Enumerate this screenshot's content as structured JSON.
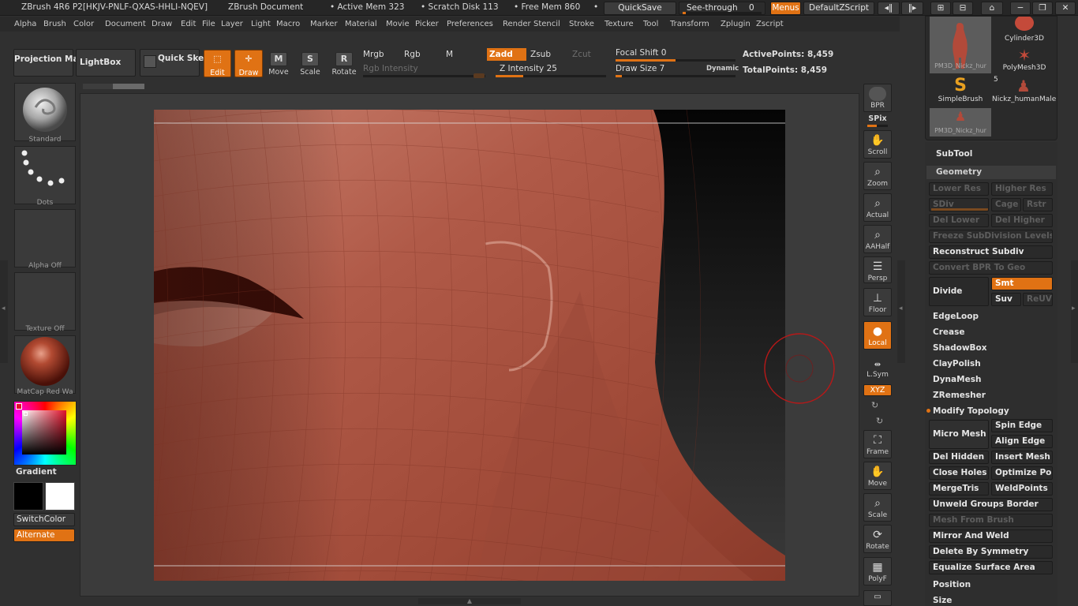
{
  "titlebar": {
    "app_title": "ZBrush 4R6 P2[HKJV-PNLF-QXAS-HHLI-NQEV]",
    "document": "ZBrush Document",
    "active_mem": "• Active Mem 323",
    "scratch_disk": "• Scratch Disk 113",
    "free_mem": "• Free Mem 860",
    "dot": "•",
    "quicksave": "QuickSave",
    "see_through_label": "See-through",
    "see_through_value": "0",
    "see_through_level": 0,
    "menus": "Menus",
    "default_zscript": "DefaultZScript"
  },
  "menubar": {
    "items": [
      "Alpha",
      "Brush",
      "Color",
      "Document",
      "Draw",
      "Edit",
      "File",
      "Layer",
      "Light",
      "Macro",
      "Marker",
      "Material",
      "Movie",
      "Picker",
      "Preferences",
      "Render",
      "Stencil",
      "Stroke",
      "Texture",
      "Tool",
      "Transform",
      "Zplugin",
      "Zscript"
    ]
  },
  "shelf": {
    "projection_master": "Projection Master",
    "lightbox": "LightBox",
    "quick_sketch": "Quick Sketch",
    "edit": "Edit",
    "draw": "Draw",
    "move": "Move",
    "scale": "Scale",
    "rotate": "Rotate",
    "mrgb": "Mrgb",
    "rgb": "Rgb",
    "m": "M",
    "zadd": "Zadd",
    "zsub": "Zsub",
    "zcut": "Zcut",
    "rgb_intensity": "Rgb Intensity",
    "z_intensity_label": "Z Intensity",
    "z_intensity_value": "25",
    "focal_shift_label": "Focal Shift",
    "focal_shift_value": "0",
    "draw_size_label": "Draw Size",
    "draw_size_value": "7",
    "dynamic": "Dynamic",
    "active_points": "ActivePoints: 8,459",
    "total_points": "TotalPoints: 8,459",
    "z_intensity_level": 25,
    "focal_shift_level": 50,
    "draw_size_level": 5
  },
  "lefttray": {
    "standard": "Standard",
    "dots": "Dots",
    "alpha_off": "Alpha Off",
    "texture_off": "Texture Off",
    "matcap": "MatCap Red Wa",
    "gradient": "Gradient",
    "switchcolor": "SwitchColor",
    "alternate": "Alternate"
  },
  "righttools": {
    "bpr": "BPR",
    "spix": "SPix",
    "scroll": "Scroll",
    "zoom": "Zoom",
    "actual": "Actual",
    "aahalf": "AAHalf",
    "persp": "Persp",
    "floor": "Floor",
    "local": "Local",
    "lsym": "L.Sym",
    "xyz": "XYZ",
    "frame": "Frame",
    "move": "Move",
    "scale": "Scale",
    "rotate": "Rotate",
    "polyf": "PolyF"
  },
  "toolpalette": {
    "thumbs": [
      "PM3D_Nickz_hur",
      "Cylinder3D",
      "PolyMesh3D",
      "SimpleBrush",
      "Nickz_humanMale",
      "PM3D_Nickz_hur"
    ],
    "count_badge": "5"
  },
  "rightpanel": {
    "subtool": "SubTool",
    "geometry": "Geometry",
    "lower_res": "Lower Res",
    "higher_res": "Higher Res",
    "sdiv": "SDiv",
    "cage": "Cage",
    "rstr": "Rstr",
    "del_lower": "Del Lower",
    "del_higher": "Del Higher",
    "freeze": "Freeze SubDivision Levels",
    "reconstruct": "Reconstruct Subdiv",
    "convert_bpr": "Convert BPR To Geo",
    "divide": "Divide",
    "smt": "Smt",
    "suv": "Suv",
    "reuv": "ReUV",
    "edgeloop": "EdgeLoop",
    "crease": "Crease",
    "shadowbox": "ShadowBox",
    "claypolish": "ClayPolish",
    "dynamesh": "DynaMesh",
    "zremesher": "ZRemesher",
    "modify_topology": "Modify Topology",
    "micro_mesh": "Micro Mesh",
    "spin_edge": "Spin Edge",
    "align_edge": "Align Edge",
    "del_hidden": "Del Hidden",
    "insert_mesh": "Insert Mesh",
    "close_holes": "Close Holes",
    "optimize_points": "Optimize Poi",
    "mergetris": "MergeTris",
    "weldpoints": "WeldPoints",
    "unweld": "Unweld Groups Border",
    "mesh_from_brush": "Mesh From Brush",
    "mirror_weld": "Mirror And Weld",
    "delete_symmetry": "Delete By Symmetry",
    "equalize": "Equalize Surface Area",
    "position": "Position",
    "size": "Size"
  },
  "colors": {
    "accent": "#e07214",
    "skin": "#a84a3a"
  }
}
